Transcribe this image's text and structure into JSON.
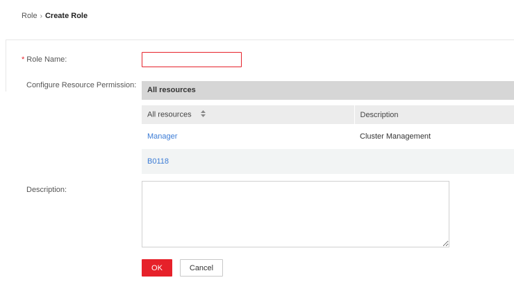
{
  "breadcrumb": {
    "parent": "Role",
    "separator": "›",
    "current": "Create Role"
  },
  "form": {
    "role_name": {
      "required_marker": "*",
      "label": "Role Name:",
      "value": "",
      "placeholder": ""
    },
    "permission": {
      "label": "Configure Resource Permission:",
      "header": "All resources",
      "columns": [
        "All resources",
        "Description"
      ],
      "sort_icon": "sort-updown-icon",
      "rows": [
        {
          "resource": "Manager",
          "description": "Cluster Management"
        },
        {
          "resource": "B0118",
          "description": ""
        }
      ]
    },
    "description": {
      "label": "Description:",
      "value": ""
    }
  },
  "actions": {
    "ok_label": "OK",
    "cancel_label": "Cancel"
  },
  "colors": {
    "accent": "#e6212a",
    "link": "#3b7bd5"
  }
}
